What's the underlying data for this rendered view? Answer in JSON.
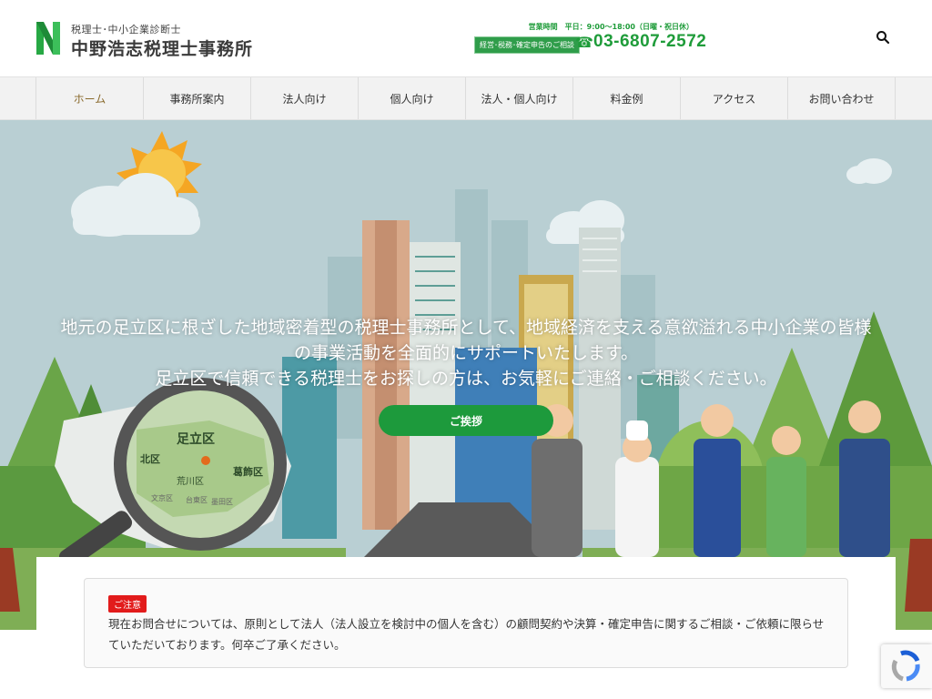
{
  "header": {
    "logo_sub": "税理士･中小企業診断士",
    "logo_main": "中野浩志税理士事務所",
    "hours": "営業時間　平日：9:00〜18:00（日曜・祝日休）",
    "consult_tag": "経営･税務･確定申告のご相談",
    "phone_icon": "☎",
    "phone": "03-6807-2572"
  },
  "nav": {
    "items": [
      {
        "label": "ホーム"
      },
      {
        "label": "事務所案内"
      },
      {
        "label": "法人向け"
      },
      {
        "label": "個人向け"
      },
      {
        "label": "法人・個人向け"
      },
      {
        "label": "料金例"
      },
      {
        "label": "アクセス"
      },
      {
        "label": "お問い合わせ"
      }
    ]
  },
  "hero": {
    "lines": [
      "地元の足立区に根ざした地域密着型の税理士事務所として、地域経済を支える意欲溢れる中小企業の皆様",
      "の事業活動を全面的にサポートいたします。",
      "足立区で信頼できる税理士をお探しの方は、お気軽にご連絡・ご相談ください。"
    ],
    "button_label": "ご挨拶",
    "map_labels": {
      "adachi": "足立区",
      "kita": "北区",
      "arakawa": "荒川区",
      "katsushika": "葛飾区",
      "bunkyo": "文京区",
      "taito": "台東区",
      "sumida": "墨田区"
    }
  },
  "notice": {
    "badge": "ご注意",
    "text": "現在お問合せについては、原則として法人（法人設立を検討中の個人を含む）の顧問契約や決算・確定申告に関するご相談・ご依頼に限らせていただいております。何卒ご了承ください。"
  },
  "colors": {
    "brand_green": "#1d9a3c",
    "nav_active": "#8a6b2e",
    "badge_red": "#e21b1b"
  }
}
